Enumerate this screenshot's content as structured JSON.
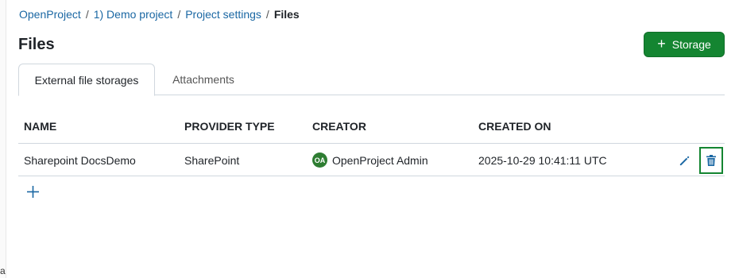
{
  "breadcrumb": {
    "items": [
      "OpenProject",
      "1) Demo project",
      "Project settings"
    ],
    "separator": "/",
    "current": "Files"
  },
  "page": {
    "title": "Files"
  },
  "actions": {
    "add_storage_label": "Storage",
    "add_storage_icon": "plus-icon"
  },
  "tabs": [
    {
      "label": "External file storages",
      "active": true
    },
    {
      "label": "Attachments",
      "active": false
    }
  ],
  "table": {
    "headers": [
      "NAME",
      "PROVIDER TYPE",
      "CREATOR",
      "CREATED ON"
    ],
    "rows": [
      {
        "name": "Sharepoint DocsDemo",
        "provider_type": "SharePoint",
        "creator_initials": "OA",
        "creator": "OpenProject Admin",
        "created_on": "2025-10-29 10:41:11 UTC"
      }
    ]
  },
  "left_edge_mark": "a",
  "colors": {
    "link": "#1a67a3",
    "primary": "#148531",
    "avatar": "#2e7d32",
    "icon_blue": "#1a67a3"
  }
}
